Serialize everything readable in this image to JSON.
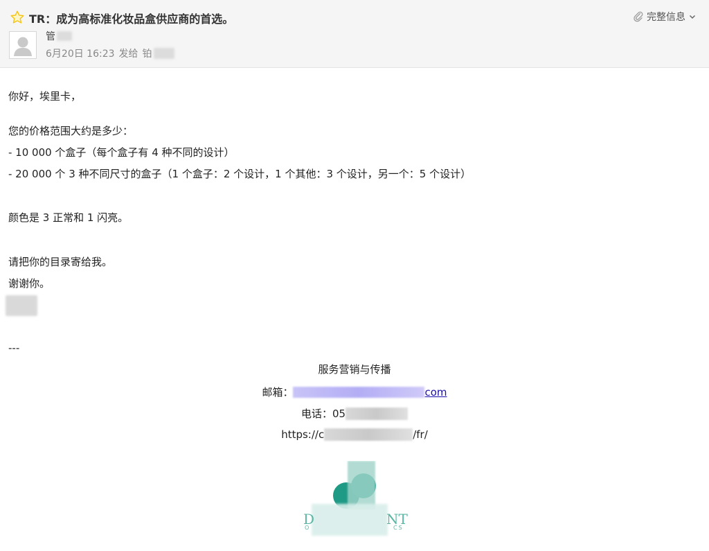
{
  "header": {
    "subject": "TR：成为高标准化妆品盒供应商的首选。",
    "full_info_label": "完整信息",
    "sender_initial": "管",
    "date": "6月20日 16:23",
    "sent_to": "发给",
    "recipient_initial": "铂"
  },
  "body": {
    "greeting": "你好，埃里卡，",
    "lines": [
      "您的价格范围大约是多少：",
      "- 10 000 个盒子（每个盒子有 4 种不同的设计）",
      "- 20 000 个 3 种不同尺寸的盒子（1 个盒子：2 个设计，1 个其他：3 个设计，另一个：5 个设计）",
      "颜色是 3 正常和 1 闪亮。",
      "请把你的目录寄给我。",
      "谢谢你。"
    ],
    "separator": "---"
  },
  "signature": {
    "title": "服务营销与传播",
    "email_label": "邮箱：",
    "email_suffix": "com",
    "phone_label": "电话：",
    "phone_prefix": "05",
    "url_prefix": "https://c",
    "url_suffix": "/fr/",
    "logo_text_left": "D",
    "logo_text_right": "NT",
    "logo_sub_left": "O",
    "logo_sub_right": "CS"
  },
  "colors": {
    "star": "#f5c518",
    "link": "#1a0dab",
    "logo_teal": "#1f9a85"
  }
}
